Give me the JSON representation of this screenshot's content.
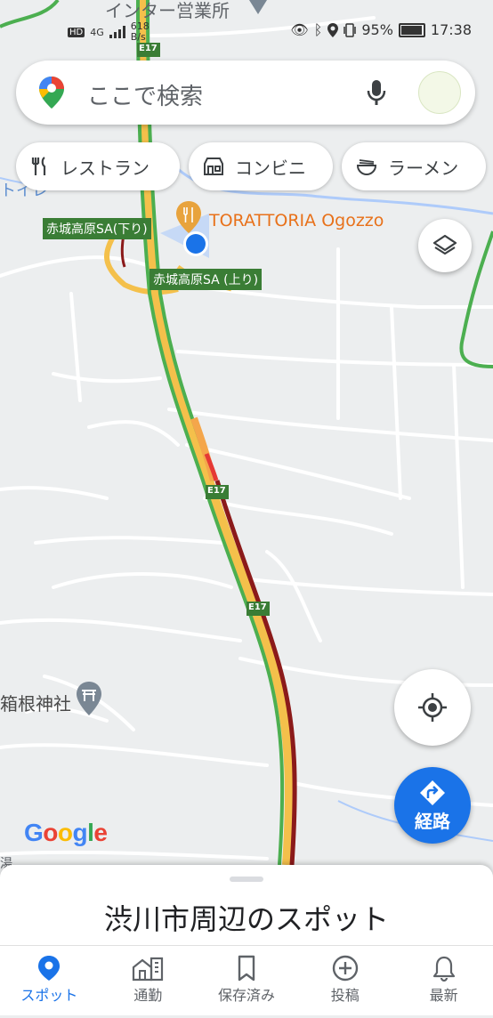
{
  "status_bar": {
    "network": "4G",
    "speed": "618",
    "speed_unit": "B/s",
    "battery": "95%",
    "battery_level": 0.95,
    "time": "17:38"
  },
  "search": {
    "placeholder": "ここで検索"
  },
  "chips": [
    {
      "icon": "restaurant-icon",
      "label": "レストラン"
    },
    {
      "icon": "convenience-store-icon",
      "label": "コンビニ"
    },
    {
      "icon": "ramen-icon",
      "label": "ラーメン"
    }
  ],
  "map": {
    "labels": {
      "inter_office": "インター営業所",
      "restaurant": "TORATTORIA Ogozzo",
      "sa_down": "赤城高原SA(下り)",
      "sa_up": "赤城高原SA (上り)",
      "shrine": "箱根神社",
      "highway": "E17",
      "partial_left": "トイレ",
      "partial_bottom": "湯"
    },
    "colors": {
      "highway_green": "#4caf50",
      "highway_orange": "#f4a64b",
      "highway_dark_red": "#8b1a1a",
      "highway_red": "#e53935",
      "sa_label_bg": "#3a7d35",
      "restaurant_text": "#e8711a",
      "water": "#aecbfa"
    }
  },
  "route_button": {
    "label": "経路"
  },
  "google_logo": {
    "text": "Google"
  },
  "sheet": {
    "title": "渋川市周辺のスポット"
  },
  "bottom_nav": [
    {
      "label": "スポット",
      "icon": "explore-pin-icon",
      "active": true
    },
    {
      "label": "通勤",
      "icon": "commute-icon",
      "active": false
    },
    {
      "label": "保存済み",
      "icon": "bookmark-icon",
      "active": false
    },
    {
      "label": "投稿",
      "icon": "add-circle-icon",
      "active": false
    },
    {
      "label": "最新",
      "icon": "bell-icon",
      "active": false
    }
  ],
  "accent_color": "#1a73e8"
}
